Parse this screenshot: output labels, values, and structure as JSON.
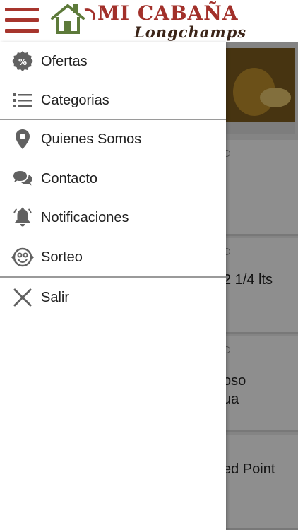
{
  "header": {
    "logo_title": "MI CABAÑA",
    "logo_subtitle": "Longchamps",
    "brand_color": "#a2302a"
  },
  "background": {
    "cards": [
      {
        "text": ""
      },
      {
        "text": "2 1/4 lts"
      },
      {
        "text_line1": "oso",
        "text_line2": "ua"
      },
      {
        "text": "ed Point"
      }
    ]
  },
  "menu": {
    "items": [
      {
        "label": "Ofertas",
        "icon": "percent-badge-icon"
      },
      {
        "label": "Categorias",
        "icon": "list-icon"
      },
      {
        "label": "Quienes Somos",
        "icon": "location-pin-icon"
      },
      {
        "label": "Contacto",
        "icon": "chat-bubbles-icon"
      },
      {
        "label": "Notificaciones",
        "icon": "bell-icon"
      },
      {
        "label": "Sorteo",
        "icon": "smiley-icon"
      },
      {
        "label": "Salir",
        "icon": "close-icon"
      }
    ]
  }
}
